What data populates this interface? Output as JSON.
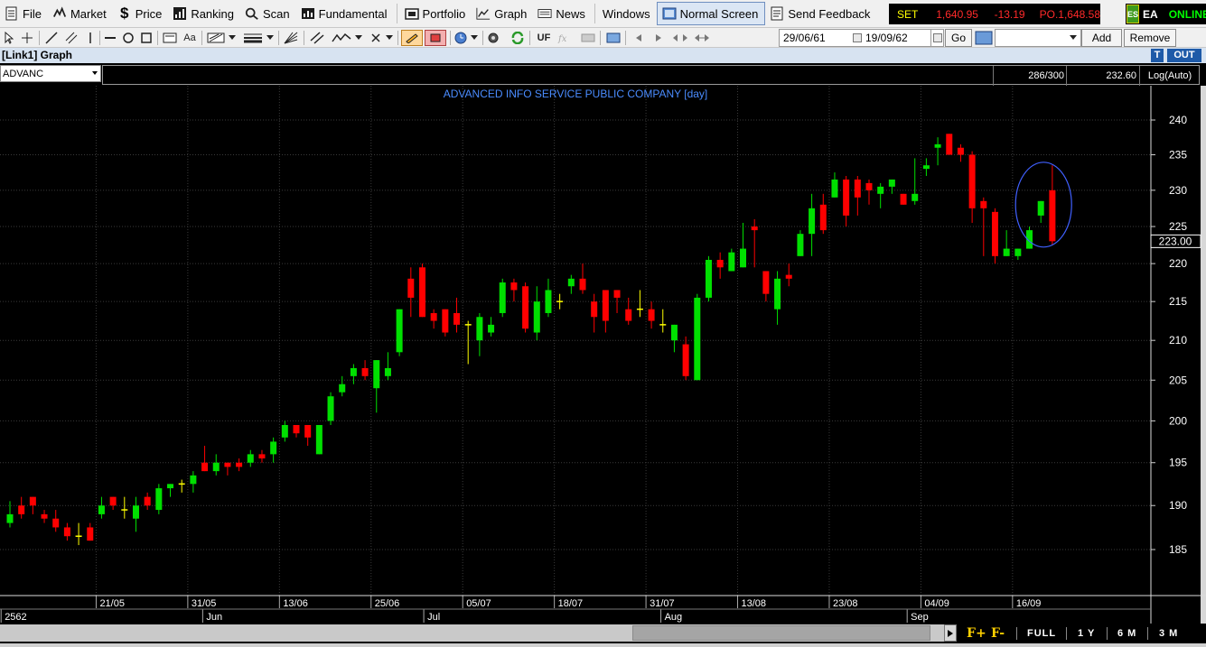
{
  "menu": {
    "file": "File",
    "market": "Market",
    "price": "Price",
    "ranking": "Ranking",
    "scan": "Scan",
    "fundamental": "Fundamental",
    "portfolio": "Portfolio",
    "graph": "Graph",
    "news": "News",
    "windows": "Windows",
    "normal_screen": "Normal Screen",
    "send_feedback": "Send Feedback"
  },
  "ticker": {
    "index_name": "SET",
    "index_value": "1,640.95",
    "index_change": "-13.19",
    "projected": "PO.1,648.58"
  },
  "connection": {
    "account": "EA",
    "status": "ONLINE",
    "logo_text": "ES"
  },
  "toolbar": {
    "text_tool": "Aa",
    "uf_label": "UF",
    "date_from": "29/06/61",
    "date_to": "19/09/62",
    "go_label": "Go",
    "add_label": "Add",
    "remove_label": "Remove"
  },
  "window": {
    "title": "[Link1] Graph",
    "t_button": "T",
    "out_button": "OUT"
  },
  "chart_header": {
    "symbol": "ADVANC",
    "bar_count": "286/300",
    "cursor_price": "232.60",
    "scale_mode": "Log(Auto)"
  },
  "colors": {
    "up": "#00e000",
    "down": "#ff0000",
    "neutral": "#ffff00",
    "background": "#000000",
    "grid": "#3a3a3a",
    "title": "#4a8cff"
  },
  "chart_data": {
    "type": "candlestick",
    "title": "ADVANCED INFO SERVICE PUBLIC COMPANY [day]",
    "ylim": [
      182,
      242
    ],
    "y_scale": "log",
    "y_ticks": [
      185,
      190,
      195,
      200,
      205,
      210,
      215,
      220,
      225,
      230,
      235,
      240
    ],
    "last_price": "223.00",
    "date_ticks": [
      {
        "index": 8,
        "label": "21/05"
      },
      {
        "index": 16,
        "label": "31/05"
      },
      {
        "index": 24,
        "label": "13/06"
      },
      {
        "index": 32,
        "label": "25/06"
      },
      {
        "index": 40,
        "label": "05/07"
      },
      {
        "index": 48,
        "label": "18/07"
      },
      {
        "index": 56,
        "label": "31/07"
      },
      {
        "index": 64,
        "label": "13/08"
      },
      {
        "index": 72,
        "label": "23/08"
      },
      {
        "index": 80,
        "label": "04/09"
      },
      {
        "index": 88,
        "label": "16/09"
      }
    ],
    "month_ticks": [
      {
        "index": -0.3,
        "label": "2562"
      },
      {
        "index": 17.3,
        "label": "Jun"
      },
      {
        "index": 36.6,
        "label": "Jul"
      },
      {
        "index": 57.3,
        "label": "Aug"
      },
      {
        "index": 78.8,
        "label": "Sep"
      }
    ],
    "highlight": {
      "index": 90,
      "price_center": 228,
      "label": "circled last candle"
    },
    "candles": [
      {
        "o": 188,
        "h": 190.5,
        "l": 187.5,
        "c": 189
      },
      {
        "o": 190,
        "h": 191,
        "l": 188.5,
        "c": 189
      },
      {
        "o": 191,
        "h": 191,
        "l": 189,
        "c": 190
      },
      {
        "o": 189,
        "h": 189.5,
        "l": 188,
        "c": 188.5
      },
      {
        "o": 188.5,
        "h": 189.5,
        "l": 187,
        "c": 187.5
      },
      {
        "o": 187.5,
        "h": 188,
        "l": 186,
        "c": 186.5
      },
      {
        "o": 186.5,
        "h": 188,
        "l": 185.5,
        "c": 186.5
      },
      {
        "o": 187.5,
        "h": 188,
        "l": 186,
        "c": 186
      },
      {
        "o": 189,
        "h": 191,
        "l": 188.5,
        "c": 190
      },
      {
        "o": 191,
        "h": 191,
        "l": 189.5,
        "c": 190
      },
      {
        "o": 189.5,
        "h": 191,
        "l": 188.5,
        "c": 189.5
      },
      {
        "o": 188.5,
        "h": 191,
        "l": 187,
        "c": 190
      },
      {
        "o": 191,
        "h": 191.5,
        "l": 189.5,
        "c": 190
      },
      {
        "o": 189.5,
        "h": 192.5,
        "l": 189,
        "c": 192
      },
      {
        "o": 192,
        "h": 192.5,
        "l": 191,
        "c": 192.5
      },
      {
        "o": 192.5,
        "h": 193,
        "l": 191.5,
        "c": 192.5
      },
      {
        "o": 192.5,
        "h": 194,
        "l": 191.5,
        "c": 193.5
      },
      {
        "o": 195,
        "h": 197,
        "l": 194,
        "c": 194
      },
      {
        "o": 194,
        "h": 196,
        "l": 193.5,
        "c": 195
      },
      {
        "o": 195,
        "h": 195,
        "l": 193.5,
        "c": 194.5
      },
      {
        "o": 195,
        "h": 195.5,
        "l": 194,
        "c": 194.5
      },
      {
        "o": 195,
        "h": 196.5,
        "l": 194.5,
        "c": 196
      },
      {
        "o": 196,
        "h": 196.5,
        "l": 195,
        "c": 195.5
      },
      {
        "o": 196,
        "h": 198,
        "l": 195,
        "c": 197.5
      },
      {
        "o": 198,
        "h": 200,
        "l": 197.5,
        "c": 199.5
      },
      {
        "o": 199.5,
        "h": 199.5,
        "l": 198,
        "c": 198.5
      },
      {
        "o": 199.5,
        "h": 199.5,
        "l": 197,
        "c": 198
      },
      {
        "o": 196,
        "h": 199.5,
        "l": 196,
        "c": 199.5
      },
      {
        "o": 200,
        "h": 203.5,
        "l": 199.5,
        "c": 203
      },
      {
        "o": 203.5,
        "h": 205.5,
        "l": 203,
        "c": 204.5
      },
      {
        "o": 205.5,
        "h": 207,
        "l": 204.5,
        "c": 206.5
      },
      {
        "o": 206.5,
        "h": 207.5,
        "l": 205,
        "c": 205.5
      },
      {
        "o": 204,
        "h": 207.5,
        "l": 201,
        "c": 207.5
      },
      {
        "o": 205.5,
        "h": 208.5,
        "l": 205,
        "c": 206.5
      },
      {
        "o": 208.5,
        "h": 214,
        "l": 208,
        "c": 214
      },
      {
        "o": 218,
        "h": 219.5,
        "l": 213,
        "c": 215.5
      },
      {
        "o": 219.5,
        "h": 220,
        "l": 213,
        "c": 213
      },
      {
        "o": 213.5,
        "h": 214,
        "l": 211.5,
        "c": 212.5
      },
      {
        "o": 214,
        "h": 214,
        "l": 210.5,
        "c": 211
      },
      {
        "o": 213.5,
        "h": 215.5,
        "l": 211,
        "c": 212
      },
      {
        "o": 212,
        "h": 212.5,
        "l": 207,
        "c": 212
      },
      {
        "o": 210,
        "h": 213.5,
        "l": 208,
        "c": 213
      },
      {
        "o": 211,
        "h": 213,
        "l": 210.5,
        "c": 212
      },
      {
        "o": 213.5,
        "h": 218,
        "l": 213,
        "c": 217.5
      },
      {
        "o": 217.5,
        "h": 218,
        "l": 215,
        "c": 216.5
      },
      {
        "o": 217,
        "h": 217.5,
        "l": 211,
        "c": 211.5
      },
      {
        "o": 211,
        "h": 217,
        "l": 210,
        "c": 215
      },
      {
        "o": 213.5,
        "h": 218,
        "l": 213,
        "c": 216.5
      },
      {
        "o": 215,
        "h": 216,
        "l": 214,
        "c": 215
      },
      {
        "o": 217,
        "h": 218.5,
        "l": 216,
        "c": 218
      },
      {
        "o": 218,
        "h": 220,
        "l": 216,
        "c": 216.5
      },
      {
        "o": 215,
        "h": 216,
        "l": 211,
        "c": 213
      },
      {
        "o": 216.5,
        "h": 216.5,
        "l": 211,
        "c": 212.5
      },
      {
        "o": 216.5,
        "h": 216.5,
        "l": 213.5,
        "c": 215.5
      },
      {
        "o": 214,
        "h": 215.5,
        "l": 212,
        "c": 212.5
      },
      {
        "o": 214,
        "h": 216.5,
        "l": 213,
        "c": 214
      },
      {
        "o": 214,
        "h": 215,
        "l": 211.5,
        "c": 212.5
      },
      {
        "o": 212,
        "h": 214,
        "l": 211,
        "c": 212
      },
      {
        "o": 210,
        "h": 212,
        "l": 208.5,
        "c": 212
      },
      {
        "o": 209.5,
        "h": 210.5,
        "l": 205,
        "c": 205.5
      },
      {
        "o": 205,
        "h": 216,
        "l": 205,
        "c": 215.5
      },
      {
        "o": 215.5,
        "h": 221,
        "l": 215,
        "c": 220.5
      },
      {
        "o": 220.5,
        "h": 221.5,
        "l": 218,
        "c": 219.5
      },
      {
        "o": 219,
        "h": 222,
        "l": 219,
        "c": 221.5
      },
      {
        "o": 219.5,
        "h": 225.5,
        "l": 219.5,
        "c": 222
      },
      {
        "o": 225,
        "h": 226,
        "l": 219.5,
        "c": 224.5
      },
      {
        "o": 219,
        "h": 219,
        "l": 215,
        "c": 216
      },
      {
        "o": 214,
        "h": 219,
        "l": 212,
        "c": 218
      },
      {
        "o": 218.5,
        "h": 220,
        "l": 217,
        "c": 218
      },
      {
        "o": 221,
        "h": 224.5,
        "l": 221,
        "c": 224
      },
      {
        "o": 224,
        "h": 229.5,
        "l": 221,
        "c": 227.5
      },
      {
        "o": 228,
        "h": 229.5,
        "l": 224,
        "c": 224.5
      },
      {
        "o": 229,
        "h": 232.5,
        "l": 229,
        "c": 231.5
      },
      {
        "o": 231.5,
        "h": 232,
        "l": 225,
        "c": 226.5
      },
      {
        "o": 231.5,
        "h": 232,
        "l": 226.5,
        "c": 229
      },
      {
        "o": 231,
        "h": 231.5,
        "l": 228,
        "c": 230
      },
      {
        "o": 229.5,
        "h": 231,
        "l": 227.5,
        "c": 230.5
      },
      {
        "o": 230.5,
        "h": 231.5,
        "l": 229.5,
        "c": 231.5
      },
      {
        "o": 229.5,
        "h": 229.5,
        "l": 228,
        "c": 228
      },
      {
        "o": 228.5,
        "h": 234.5,
        "l": 228,
        "c": 229.5
      },
      {
        "o": 233,
        "h": 234.5,
        "l": 232,
        "c": 233.5
      },
      {
        "o": 236,
        "h": 237.5,
        "l": 233.5,
        "c": 236.5
      },
      {
        "o": 238,
        "h": 238,
        "l": 235,
        "c": 235
      },
      {
        "o": 236,
        "h": 236.5,
        "l": 234,
        "c": 235
      },
      {
        "o": 235,
        "h": 235.5,
        "l": 225.5,
        "c": 227.5
      },
      {
        "o": 228.5,
        "h": 229,
        "l": 221,
        "c": 227.5
      },
      {
        "o": 227,
        "h": 227.5,
        "l": 220,
        "c": 221
      },
      {
        "o": 221,
        "h": 224.5,
        "l": 221,
        "c": 222
      },
      {
        "o": 221,
        "h": 222,
        "l": 220.5,
        "c": 222
      },
      {
        "o": 222,
        "h": 225,
        "l": 222,
        "c": 224.5
      },
      {
        "o": 226.5,
        "h": 228.5,
        "l": 225.5,
        "c": 228.5
      },
      {
        "o": 230,
        "h": 233.5,
        "l": 222.5,
        "c": 223
      }
    ]
  },
  "bottom": {
    "zoom_in": "F+",
    "zoom_out": "F-",
    "range_full": "FULL",
    "range_1y": "1 Y",
    "range_6m": "6 M",
    "range_3m": "3 M"
  }
}
